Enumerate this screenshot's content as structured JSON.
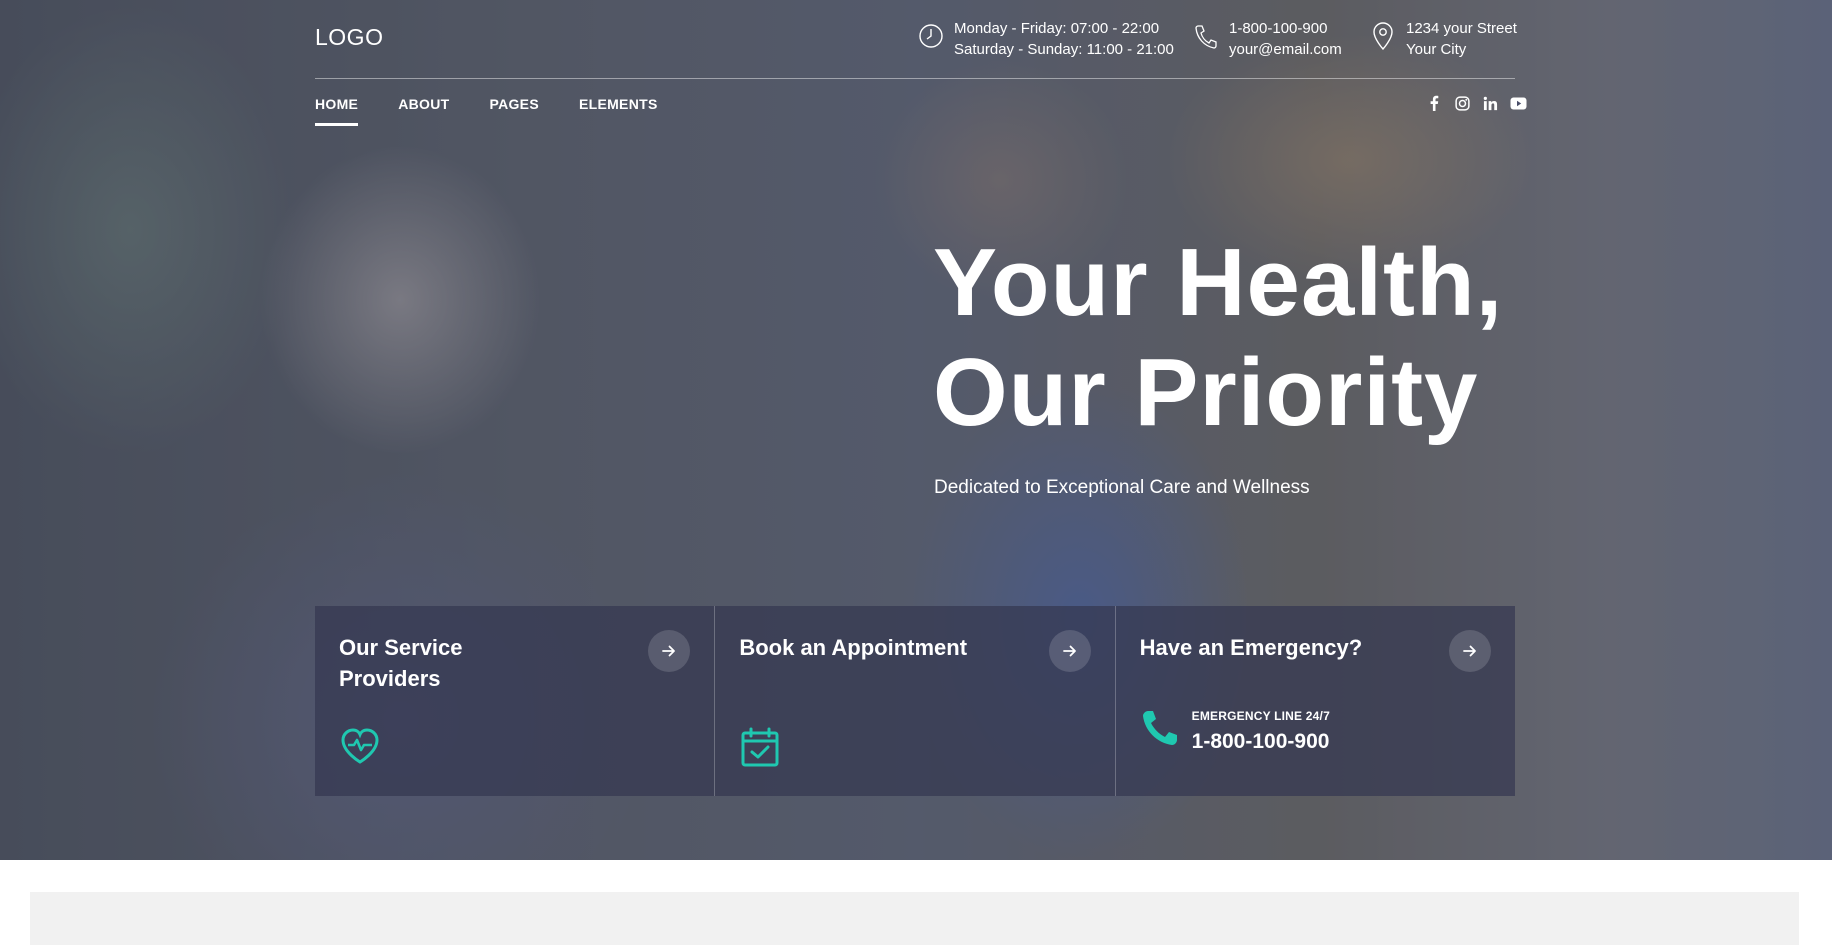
{
  "header": {
    "logo": "LOGO",
    "hours": {
      "line1": "Monday - Friday: 07:00 - 22:00",
      "line2": "Saturday - Sunday: 11:00 - 21:00",
      "icon": "clock-icon"
    },
    "contact": {
      "line1": "1-800-100-900",
      "line2": "your@email.com",
      "icon": "phone-icon"
    },
    "address": {
      "line1": "1234 your Street",
      "line2": "Your City",
      "icon": "map-pin-icon"
    }
  },
  "nav": {
    "items": [
      {
        "label": "HOME",
        "active": true
      },
      {
        "label": "ABOUT",
        "active": false
      },
      {
        "label": "PAGES",
        "active": false
      },
      {
        "label": "ELEMENTS",
        "active": false
      }
    ],
    "socials": [
      "facebook-icon",
      "instagram-icon",
      "linkedin-icon",
      "youtube-icon"
    ]
  },
  "hero": {
    "headline_line1": "Your Health,",
    "headline_line2": "Our Priority",
    "subheadline": "Dedicated to Exceptional Care and Wellness"
  },
  "cards": [
    {
      "title": "Our Service Providers",
      "icon": "heart-pulse-icon"
    },
    {
      "title": "Book an Appointment",
      "icon": "calendar-check-icon"
    },
    {
      "title": "Have an Emergency?",
      "emergency_label": "EMERGENCY LINE 24/7",
      "emergency_number": "1-800-100-900",
      "icon": "phone-icon"
    }
  ],
  "colors": {
    "accent": "#1fc8b0",
    "card_bg": "#343850",
    "text": "#ffffff"
  }
}
